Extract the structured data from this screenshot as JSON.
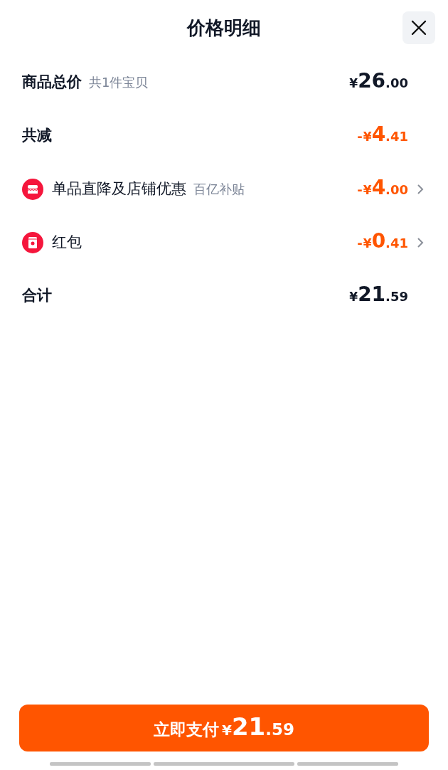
{
  "title": "价格明细",
  "rows": [
    {
      "kind": "amount",
      "label": "商品总价",
      "note": "共1件宝贝",
      "price": {
        "currency": "¥",
        "integer": "26",
        "decimal": ".00"
      },
      "chevron": false
    },
    {
      "kind": "reduction",
      "label": "共减",
      "price": {
        "sign": "-",
        "currency": "¥",
        "integer": "4",
        "decimal": ".41"
      },
      "chevron": false
    },
    {
      "kind": "shop",
      "label": "单品直降及店铺优惠",
      "note": "百亿补贴",
      "price": {
        "sign": "-",
        "currency": "¥",
        "integer": "4",
        "decimal": ".00"
      },
      "chevron": true
    },
    {
      "kind": "packet",
      "label": "红包",
      "price": {
        "sign": "-",
        "currency": "¥",
        "integer": "0",
        "decimal": ".41"
      },
      "chevron": true
    },
    {
      "kind": "amount",
      "label": "合计",
      "price": {
        "currency": "¥",
        "integer": "21",
        "decimal": ".59"
      },
      "chevron": false
    }
  ],
  "pay_button": {
    "label": "立即支付",
    "currency": "¥",
    "integer": "21",
    "decimal": ".59"
  }
}
